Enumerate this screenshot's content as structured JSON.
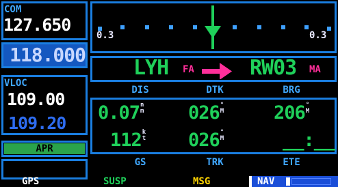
{
  "com": {
    "label": "COM",
    "active": "127.650",
    "standby": "118.000"
  },
  "vloc": {
    "label": "VLOC",
    "active": "109.00",
    "standby": "109.20"
  },
  "apr_label": "APR",
  "cdi": {
    "scale_left": "0.3",
    "scale_right": "0.3"
  },
  "waypoints": {
    "from": "LYH",
    "from_type": "FA",
    "to": "RW03",
    "to_type": "MA"
  },
  "fields": {
    "dis": {
      "label": "DIS",
      "value": "0.07",
      "unit_top": "n",
      "unit_bottom": "m"
    },
    "dtk": {
      "label": "DTK",
      "value": "026",
      "unit_top": "°",
      "unit_bottom": "M"
    },
    "brg": {
      "label": "BRG",
      "value": "206",
      "unit_top": "°",
      "unit_bottom": "M"
    },
    "gs": {
      "label": "GS",
      "value": "112",
      "unit_top": "k",
      "unit_bottom": "t"
    },
    "trk": {
      "label": "TRK",
      "value": "026",
      "unit_top": "°",
      "unit_bottom": "M"
    },
    "ete": {
      "label": "ETE",
      "value": "__:__"
    }
  },
  "status_bar": {
    "gps": "GPS",
    "susp": "SUSP",
    "msg": "MSG",
    "nav": "NAV"
  },
  "colors": {
    "frame": "#1a7ee0",
    "label": "#40a8ff",
    "value": "#1fd05a",
    "magenta": "#ff2f9a",
    "msg": "#ffd400"
  }
}
